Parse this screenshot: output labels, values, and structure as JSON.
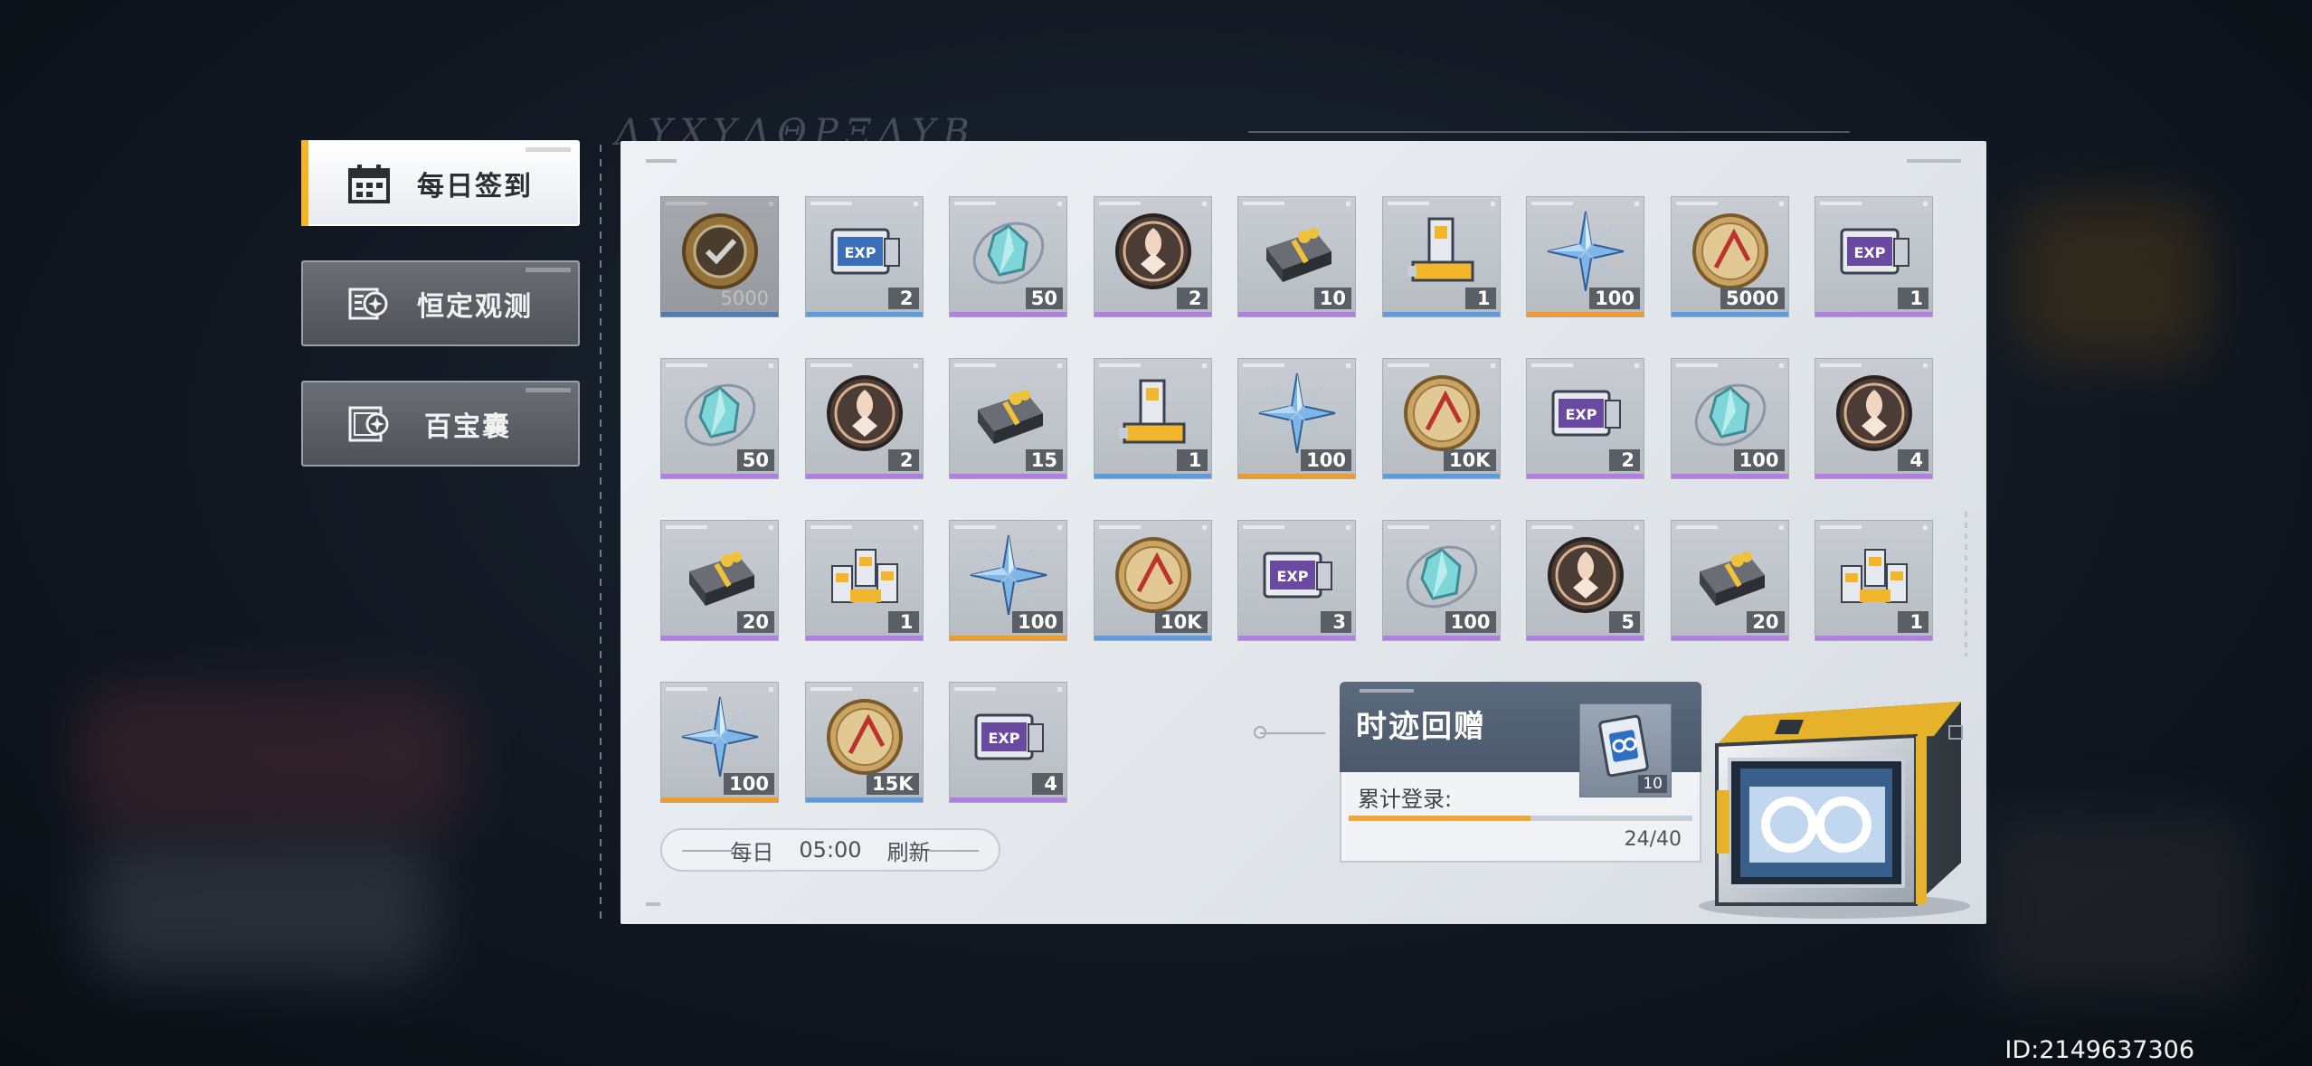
{
  "nav": {
    "items": [
      {
        "label": "每日签到",
        "icon": "calendar-icon",
        "active": true
      },
      {
        "label": "恒定观测",
        "icon": "observation-icon",
        "active": false
      },
      {
        "label": "百宝囊",
        "icon": "treasure-bag-icon",
        "active": false
      }
    ]
  },
  "rewards": [
    {
      "icon": "checked-coin-icon",
      "qty": "5000",
      "rarity": "blue",
      "claimed": true
    },
    {
      "icon": "exp-chip-blue-icon",
      "qty": "2",
      "rarity": "blue"
    },
    {
      "icon": "crystal-shard-icon",
      "qty": "50",
      "rarity": "purple"
    },
    {
      "icon": "emblem-coin-icon",
      "qty": "2",
      "rarity": "purple"
    },
    {
      "icon": "gift-box-icon",
      "qty": "10",
      "rarity": "purple"
    },
    {
      "icon": "cartridge-icon",
      "qty": "1",
      "rarity": "blue"
    },
    {
      "icon": "star-crystal-icon",
      "qty": "100",
      "rarity": "orange"
    },
    {
      "icon": "gold-coin-icon",
      "qty": "5000",
      "rarity": "blue"
    },
    {
      "icon": "exp-chip-purple-icon",
      "qty": "1",
      "rarity": "purple"
    },
    {
      "icon": "crystal-shard-icon",
      "qty": "50",
      "rarity": "purple"
    },
    {
      "icon": "emblem-coin-icon",
      "qty": "2",
      "rarity": "purple"
    },
    {
      "icon": "gift-box-icon",
      "qty": "15",
      "rarity": "purple"
    },
    {
      "icon": "cartridge-icon",
      "qty": "1",
      "rarity": "blue"
    },
    {
      "icon": "star-crystal-icon",
      "qty": "100",
      "rarity": "orange"
    },
    {
      "icon": "gold-coin-icon",
      "qty": "10K",
      "rarity": "blue"
    },
    {
      "icon": "exp-chip-purple-icon",
      "qty": "2",
      "rarity": "purple"
    },
    {
      "icon": "crystal-shard-icon",
      "qty": "100",
      "rarity": "purple"
    },
    {
      "icon": "emblem-coin-icon",
      "qty": "4",
      "rarity": "purple"
    },
    {
      "icon": "gift-box-icon",
      "qty": "20",
      "rarity": "purple"
    },
    {
      "icon": "cartridge-bundle-icon",
      "qty": "1",
      "rarity": "purple"
    },
    {
      "icon": "star-crystal-icon",
      "qty": "100",
      "rarity": "orange"
    },
    {
      "icon": "gold-coin-icon",
      "qty": "10K",
      "rarity": "blue"
    },
    {
      "icon": "exp-chip-purple-icon",
      "qty": "3",
      "rarity": "purple"
    },
    {
      "icon": "crystal-shard-icon",
      "qty": "100",
      "rarity": "purple"
    },
    {
      "icon": "emblem-coin-icon",
      "qty": "5",
      "rarity": "purple"
    },
    {
      "icon": "gift-box-icon",
      "qty": "20",
      "rarity": "purple"
    },
    {
      "icon": "cartridge-bundle-icon",
      "qty": "1",
      "rarity": "purple"
    },
    {
      "icon": "star-crystal-icon",
      "qty": "100",
      "rarity": "orange"
    },
    {
      "icon": "gold-coin-icon",
      "qty": "15K",
      "rarity": "blue"
    },
    {
      "icon": "exp-chip-purple-icon",
      "qty": "4",
      "rarity": "purple"
    }
  ],
  "refresh": {
    "prefix": "每日",
    "time": "05:00",
    "suffix": "刷新"
  },
  "cumulative": {
    "title": "时迹回赠",
    "label": "累计登录:",
    "current": 24,
    "total": 40,
    "count_text": "24/40",
    "reward_qty": "10",
    "reward_icon": "ticket-device-icon"
  },
  "user": {
    "id_text": "ID:2149637306"
  },
  "colors": {
    "accent": "#f4b523",
    "rarity_blue": "#5d9be0",
    "rarity_purple": "#b27ee6",
    "rarity_orange": "#f29c26",
    "progress": "#f0a43a"
  }
}
